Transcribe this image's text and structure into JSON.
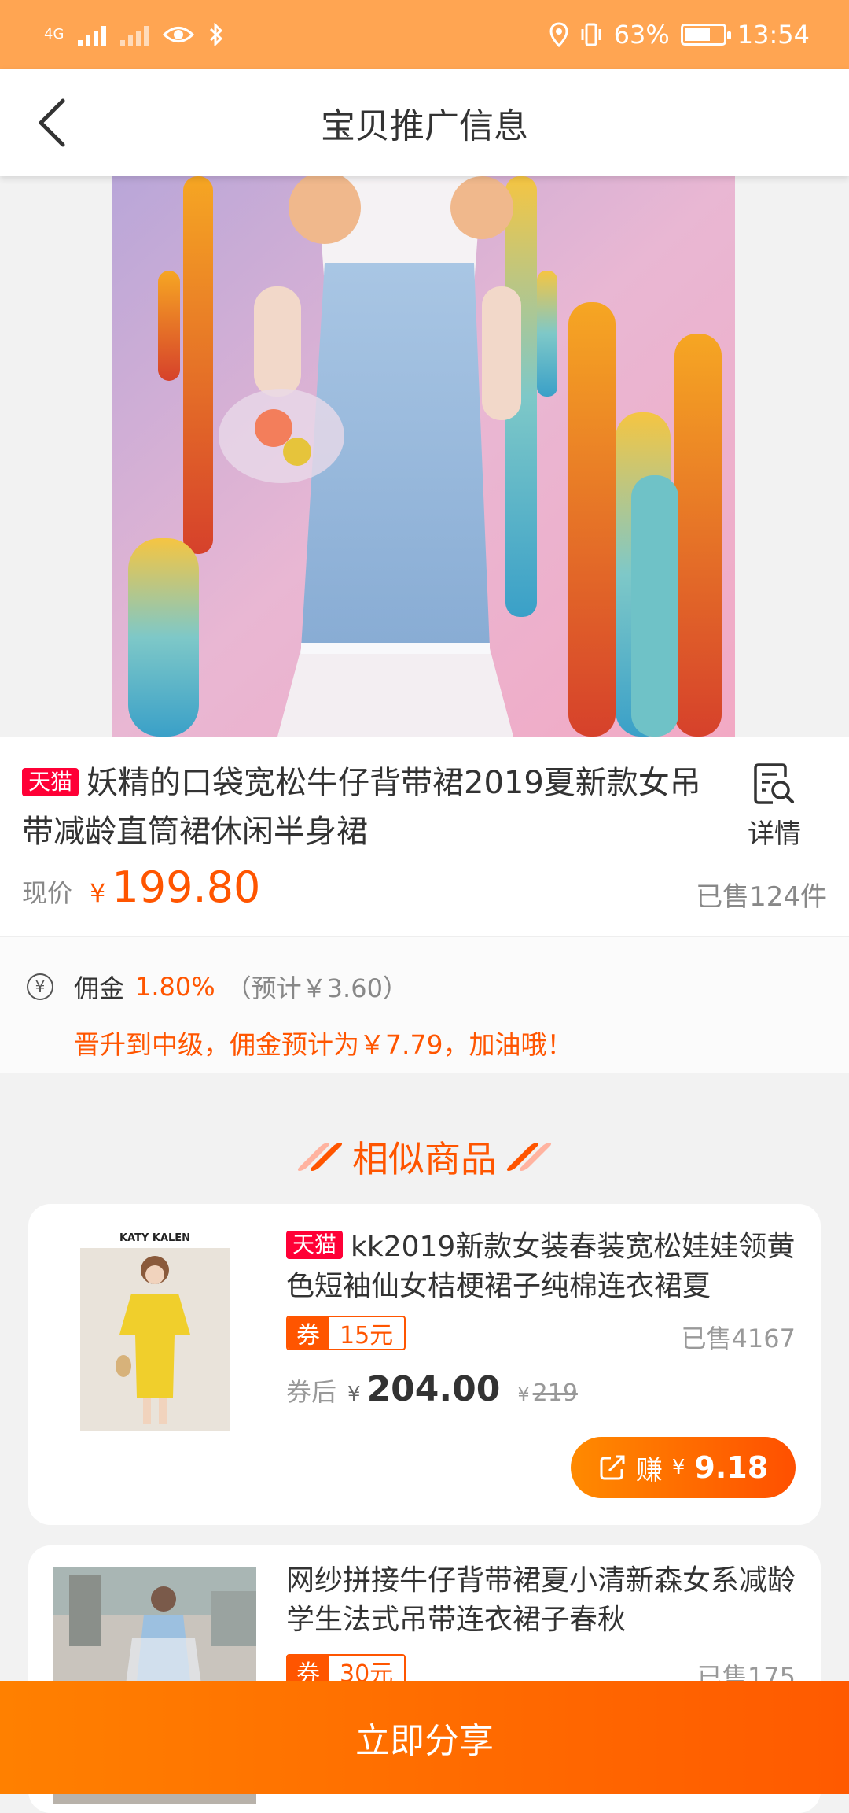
{
  "status_bar": {
    "network": "4G",
    "battery": "63%",
    "time": "13:54"
  },
  "nav": {
    "title": "宝贝推广信息"
  },
  "product": {
    "badge": "天猫",
    "title": "妖精的口袋宽松牛仔背带裙2019夏新款女吊带减龄直筒裙休闲半身裙",
    "detail_label": "详情",
    "price_label": "现价",
    "currency": "¥",
    "price": "199.80",
    "sold": "已售124件"
  },
  "commission": {
    "label": "佣金",
    "rate": "1.80%",
    "estimate": "（预计￥3.60）",
    "tip": "晋升到中级，佣金预计为￥7.79，加油哦！"
  },
  "similar": {
    "title": "相似商品",
    "items": [
      {
        "brand": "KATY KALEN",
        "badge": "天猫",
        "title": "kk2019新款女装春装宽松娃娃领黄色短袖仙女桔梗裙子纯棉连衣裙夏",
        "coupon_key": "券",
        "coupon_value": "15元",
        "sold": "已售4167",
        "after_label": "券后",
        "currency": "¥",
        "after_price": "204.00",
        "orig_price": "219",
        "earn_label": "赚",
        "earn_amount": "9.18"
      },
      {
        "title": "网纱拼接牛仔背带裙夏小清新森女系减龄学生法式吊带连衣裙子春秋",
        "coupon_key": "券",
        "coupon_value": "30元",
        "sold": "已售175"
      }
    ]
  },
  "share_button": "立即分享",
  "colors": {
    "accent": "#ff5500",
    "status_bar": "#ffa552",
    "tmall": "#ff0036"
  }
}
